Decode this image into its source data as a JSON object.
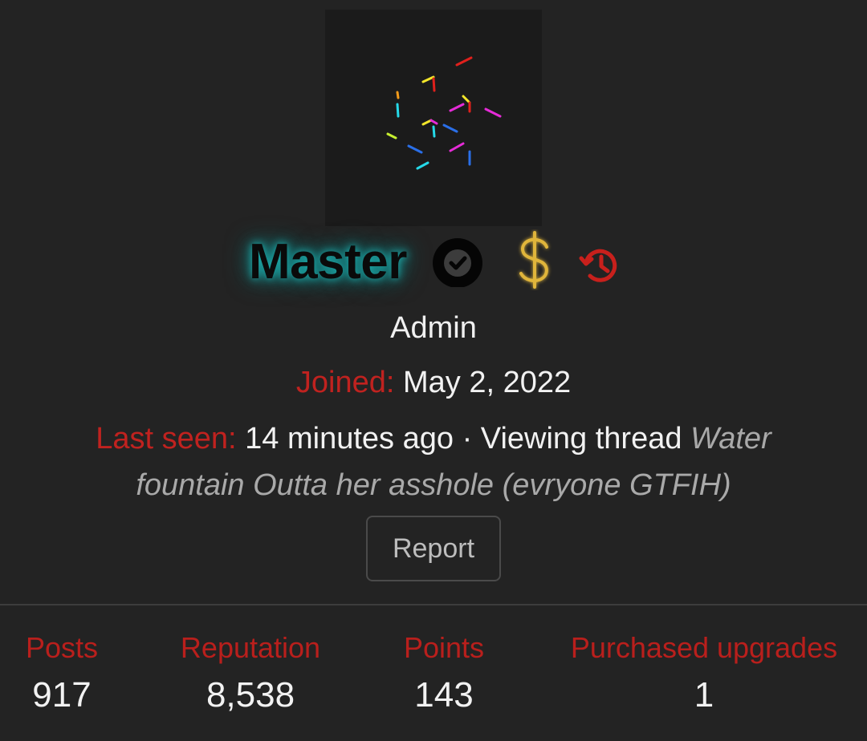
{
  "profile": {
    "username": "Master",
    "role": "Admin",
    "joined_label": "Joined:",
    "joined_value": "May 2, 2022",
    "last_seen_label": "Last seen:",
    "last_seen_time": "14 minutes ago",
    "separator": " · ",
    "activity_text": "Viewing thread",
    "thread_title": "Water fountain Outta her asshole (evryone GTFIH)",
    "report_label": "Report",
    "icons": {
      "avatar": "confetti-lines-avatar",
      "verified": "check-circle-icon",
      "upgrade": "dollar-sign-icon",
      "history": "history-icon"
    },
    "colors": {
      "background": "#232323",
      "label_red": "#c0221f",
      "username_glow": "#1fb6b6",
      "dollar_gold": "#e0b53a",
      "history_red": "#c8201c"
    }
  },
  "stats": [
    {
      "label": "Posts",
      "value": "917"
    },
    {
      "label": "Reputation",
      "value": "8,538"
    },
    {
      "label": "Points",
      "value": "143"
    },
    {
      "label": "Purchased upgrades",
      "value": "1"
    }
  ]
}
